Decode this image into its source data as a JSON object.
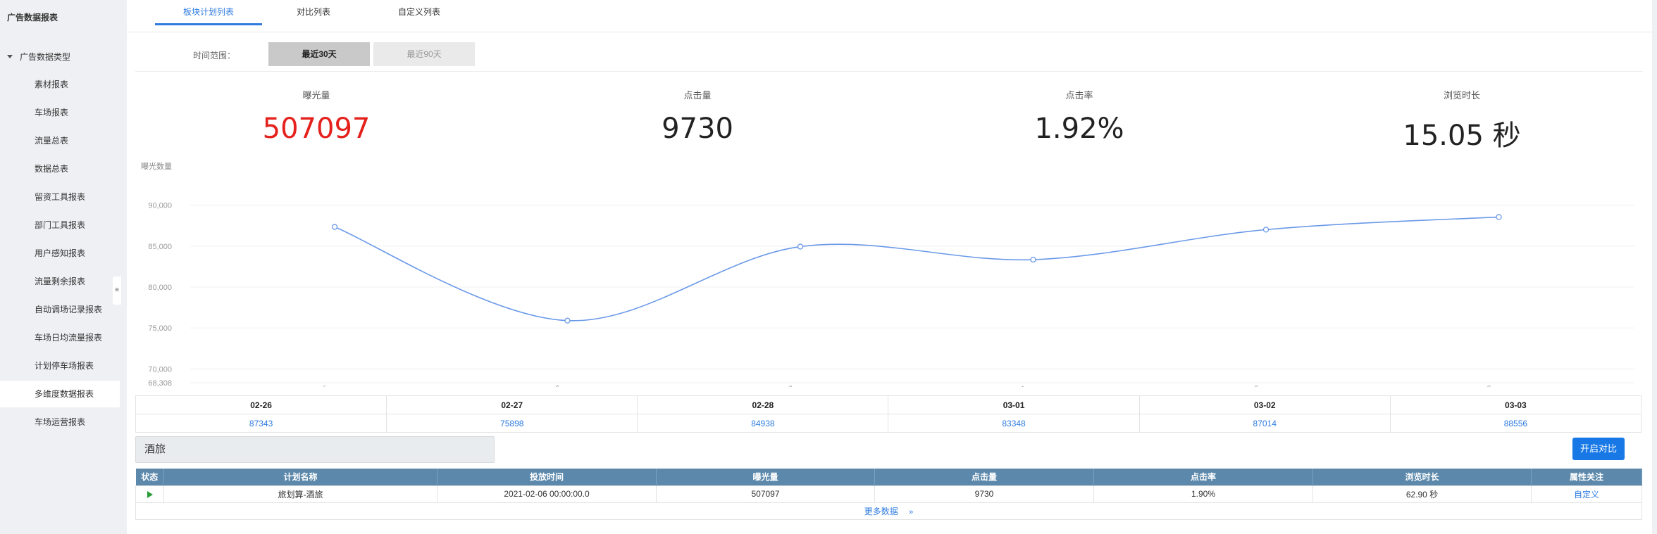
{
  "sidebar": {
    "app_title": "广告数据报表",
    "group_label": "广告数据类型",
    "items": [
      {
        "label": "素材报表"
      },
      {
        "label": "车场报表"
      },
      {
        "label": "流量总表"
      },
      {
        "label": "数据总表"
      },
      {
        "label": "留资工具报表"
      },
      {
        "label": "部门工具报表"
      },
      {
        "label": "用户感知报表"
      },
      {
        "label": "流量剩余报表"
      },
      {
        "label": "自动调场记录报表"
      },
      {
        "label": "车场日均流量报表"
      },
      {
        "label": "计划停车场报表"
      },
      {
        "label": "多维度数据报表"
      },
      {
        "label": "车场运营报表"
      }
    ],
    "active_index": 11
  },
  "tabs": [
    "板块计划列表",
    "对比列表",
    "自定义列表"
  ],
  "range": {
    "label": "时间范围：",
    "options": [
      "最近30天",
      "最近90天"
    ]
  },
  "stats": [
    {
      "label": "曝光量",
      "value": "507097",
      "color": "#e4211c"
    },
    {
      "label": "点击量",
      "value": "9730"
    },
    {
      "label": "点击率",
      "value": "1.92%"
    },
    {
      "label": "浏览时长",
      "value": "15.05 秒"
    }
  ],
  "chart_data": {
    "type": "line",
    "ylabel": "曝光数量",
    "x": [
      "02-26",
      "02-27",
      "02-28",
      "03-01",
      "03-02",
      "03-03"
    ],
    "values": [
      87343,
      75898,
      84938,
      83348,
      87014,
      88556
    ],
    "y_ticks": [
      "90,000",
      "85,000",
      "80,000",
      "75,000",
      "70,000",
      "68,308"
    ],
    "ylim": [
      68308,
      91000
    ],
    "grid": true,
    "smooth": true,
    "color": "#6a99e8"
  },
  "date_table": {
    "dates": [
      "02-26",
      "02-27",
      "02-28",
      "03-01",
      "03-02",
      "03-03"
    ],
    "values": [
      "87343",
      "75898",
      "84938",
      "83348",
      "87014",
      "88556"
    ]
  },
  "filter": {
    "value": "酒旅"
  },
  "compare_button": "开启对比",
  "plan_table": {
    "headers": [
      "状态",
      "计划名称",
      "投放时间",
      "曝光量",
      "点击量",
      "点击率",
      "浏览时长",
      "属性关注"
    ],
    "row": {
      "name": "旅划算-酒旅",
      "time": "2021-02-06 00:00:00.0",
      "exposure": "507097",
      "clicks": "9730",
      "ctr": "1.90%",
      "duration": "62.90 秒",
      "attr": "自定义"
    },
    "more": "更多数据",
    "more_icon": "»"
  }
}
